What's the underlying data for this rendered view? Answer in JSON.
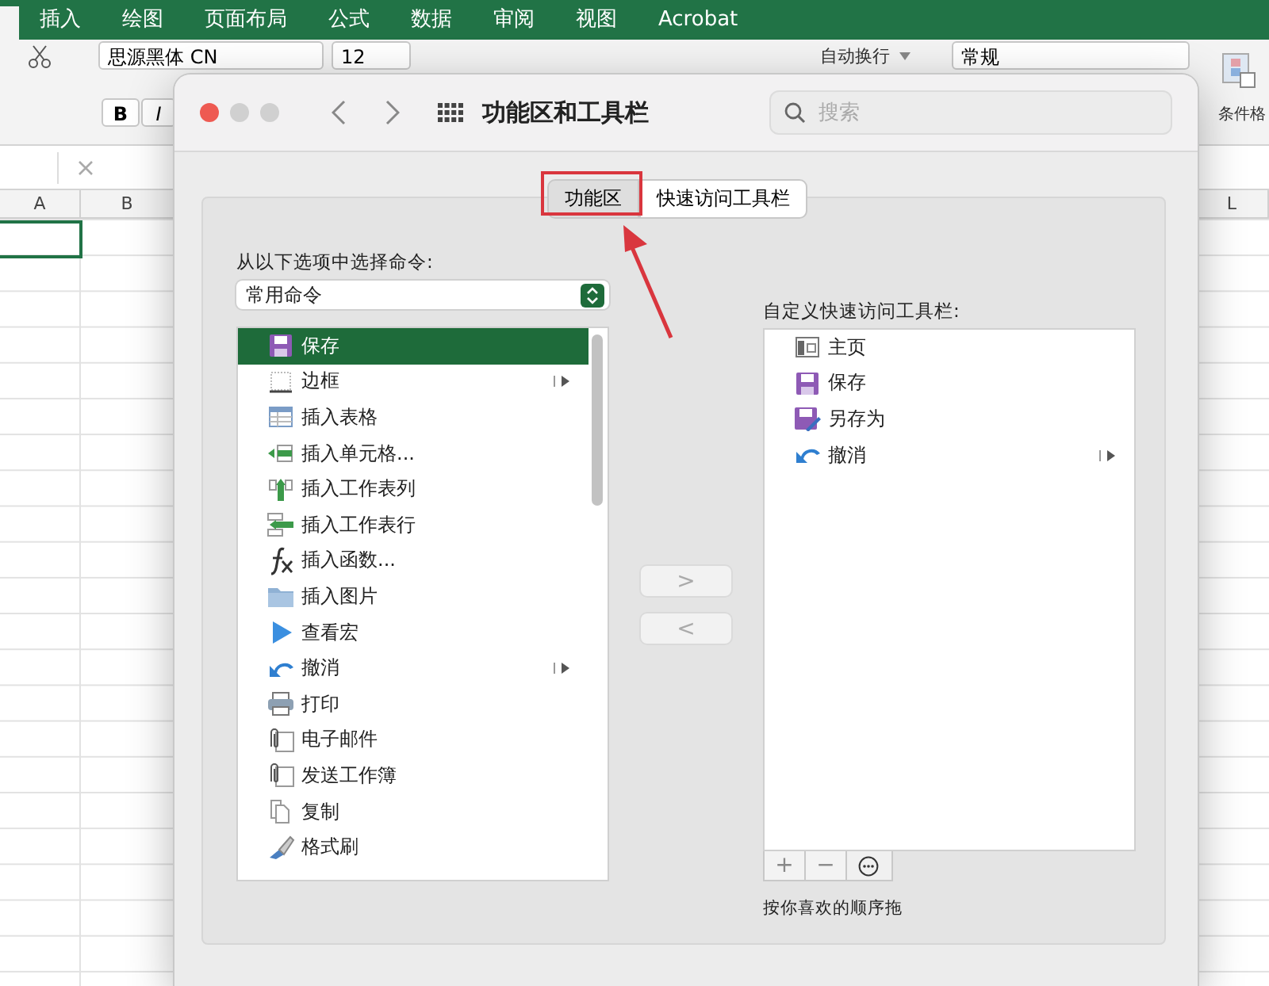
{
  "ribbon": {
    "tabs": [
      "插入",
      "绘图",
      "页面布局",
      "公式",
      "数据",
      "审阅",
      "视图",
      "Acrobat"
    ]
  },
  "toolbar": {
    "font": "思源黑体 CN",
    "size": "12",
    "bold": "B",
    "italic": "I",
    "wrap": "自动换行",
    "number_format": "常规",
    "conditional_format": "条件格"
  },
  "sheet": {
    "columns": [
      "A",
      "B",
      "L"
    ]
  },
  "dialog": {
    "title": "功能区和工具栏",
    "search": {
      "placeholder": "搜索"
    },
    "tabs": [
      {
        "label": "功能区",
        "selected": true
      },
      {
        "label": "快速访问工具栏",
        "selected": false
      }
    ],
    "commands": {
      "label": "从以下选项中选择命令:",
      "popup": "常用命令",
      "items": [
        {
          "label": "保存",
          "selected": true,
          "submenu": false
        },
        {
          "label": "边框",
          "selected": false,
          "submenu": true
        },
        {
          "label": "插入表格",
          "selected": false,
          "submenu": false
        },
        {
          "label": "插入单元格...",
          "selected": false,
          "submenu": false
        },
        {
          "label": "插入工作表列",
          "selected": false,
          "submenu": false
        },
        {
          "label": "插入工作表行",
          "selected": false,
          "submenu": false
        },
        {
          "label": "插入函数...",
          "selected": false,
          "submenu": false
        },
        {
          "label": "插入图片",
          "selected": false,
          "submenu": false
        },
        {
          "label": "查看宏",
          "selected": false,
          "submenu": false
        },
        {
          "label": "撤消",
          "selected": false,
          "submenu": true
        },
        {
          "label": "打印",
          "selected": false,
          "submenu": false
        },
        {
          "label": "电子邮件",
          "selected": false,
          "submenu": false
        },
        {
          "label": "发送工作簿",
          "selected": false,
          "submenu": false
        },
        {
          "label": "复制",
          "selected": false,
          "submenu": false
        },
        {
          "label": "格式刷",
          "selected": false,
          "submenu": false
        }
      ]
    },
    "move_buttons": [
      {
        "label": ">",
        "disabled": true
      },
      {
        "label": "<",
        "disabled": true
      }
    ],
    "toolbar_list": {
      "label": "自定义快速访问工具栏:",
      "items": [
        {
          "label": "主页",
          "submenu": false
        },
        {
          "label": "保存",
          "submenu": false
        },
        {
          "label": "另存为",
          "submenu": false
        },
        {
          "label": "撤消",
          "submenu": true
        }
      ]
    },
    "list_buttons": [
      "+",
      "−"
    ],
    "hint": "按你喜欢的顺序拖"
  }
}
